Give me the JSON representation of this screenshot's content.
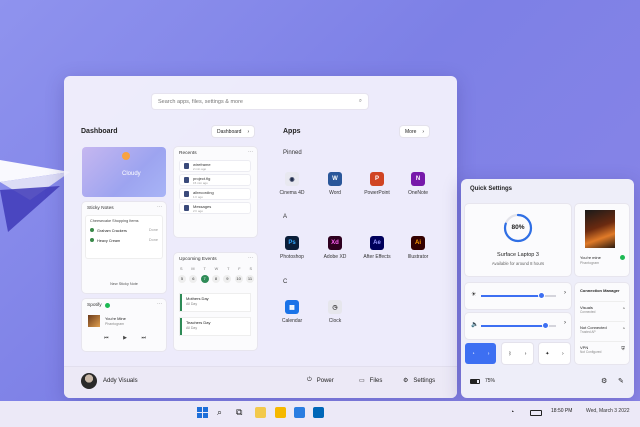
{
  "search": {
    "placeholder": "Search apps, files, settings & more"
  },
  "dashboard": {
    "title": "Dashboard",
    "button": "Dashboard",
    "weather": {
      "label": "Cloudy"
    },
    "recents": {
      "title": "Recents",
      "items": [
        {
          "name": "wireframe",
          "meta": "2 min ago"
        },
        {
          "name": "project.fig",
          "meta": "15 min ago"
        },
        {
          "name": "allrecording",
          "meta": "1 h ago"
        },
        {
          "name": "Messages",
          "meta": "2 h ago"
        }
      ]
    },
    "sticky": {
      "title": "Sticky Notes",
      "note_title": "Cheesecake Shopping Items",
      "items": [
        {
          "label": "Graham Crackers",
          "state": "Done"
        },
        {
          "label": "Heavy Cream",
          "state": "Done"
        }
      ],
      "new_note": "New Sticky Note"
    },
    "events": {
      "title": "Upcoming Events",
      "days": [
        "S",
        "M",
        "T",
        "W",
        "T",
        "F",
        "S"
      ],
      "dates": [
        "5",
        "6",
        "7",
        "8",
        "9",
        "10",
        "11"
      ],
      "selected": "7",
      "items": [
        {
          "name": "Mothers Day",
          "time": "All Day"
        },
        {
          "name": "Teachers Day",
          "time": "All Day"
        }
      ]
    },
    "spotify": {
      "title": "Spotify",
      "track": "You're Mine",
      "artist": "Phantogram"
    }
  },
  "apps": {
    "title": "Apps",
    "more": "More",
    "pinned": "Pinned",
    "groups": [
      {
        "letter": "",
        "items": [
          {
            "name": "Cinema 4D",
            "icon": "cinema4d-icon",
            "glyph": "◉",
            "bg": "#e8e8f0",
            "fg": "#1e2a4a"
          },
          {
            "name": "Word",
            "icon": "word-icon",
            "glyph": "W",
            "bg": "#2b579a",
            "fg": "#ffffff"
          },
          {
            "name": "PowerPoint",
            "icon": "powerpoint-icon",
            "glyph": "P",
            "bg": "#d04423",
            "fg": "#ffffff"
          },
          {
            "name": "OneNote",
            "icon": "onenote-icon",
            "glyph": "N",
            "bg": "#7719aa",
            "fg": "#ffffff"
          }
        ]
      },
      {
        "letter": "A",
        "items": [
          {
            "name": "Photoshop",
            "icon": "photoshop-icon",
            "glyph": "Ps",
            "bg": "#0b1e39",
            "fg": "#31a8ff"
          },
          {
            "name": "Adobe XD",
            "icon": "adobe-xd-icon",
            "glyph": "Xd",
            "bg": "#2e001f",
            "fg": "#ff61f6"
          },
          {
            "name": "After Effects",
            "icon": "after-effects-icon",
            "glyph": "Ae",
            "bg": "#00005b",
            "fg": "#9999ff"
          },
          {
            "name": "Illustrator",
            "icon": "illustrator-icon",
            "glyph": "Ai",
            "bg": "#330000",
            "fg": "#ff9a00"
          }
        ]
      },
      {
        "letter": "C",
        "items": [
          {
            "name": "Calendar",
            "icon": "calendar-icon",
            "glyph": "▦",
            "bg": "#1a73e8",
            "fg": "#ffffff"
          },
          {
            "name": "Clock",
            "icon": "clock-icon",
            "glyph": "◷",
            "bg": "#e6e6ec",
            "fg": "#333333"
          }
        ]
      }
    ]
  },
  "user": {
    "name": "Addy Visuals"
  },
  "footer": {
    "power": "Power",
    "files": "Files",
    "settings": "Settings"
  },
  "quick_settings": {
    "title": "Quick Settings",
    "battery": {
      "percent": "80%",
      "level": 0.8,
      "device": "Surface Laptop 3",
      "remaining": "Available for around 8 hours"
    },
    "music": {
      "track": "You're mine",
      "artist": "Phantogram"
    },
    "brightness": 0.8,
    "volume": 0.85,
    "connection": {
      "title": "Connection Manager",
      "items": [
        {
          "name": "Visuals",
          "status": "Connected"
        },
        {
          "name": "Not Connected",
          "status": "Trusted AP"
        },
        {
          "name": "VPN",
          "status": "Not Configured"
        }
      ]
    },
    "battery_footer": "75%"
  },
  "taskbar": {
    "time": "18:50 PM",
    "date": "Wed, March 3 2022"
  },
  "colors": {
    "accent": "#3d6ff2",
    "battery_ring": "#2f6fe5",
    "green": "#1db954"
  }
}
